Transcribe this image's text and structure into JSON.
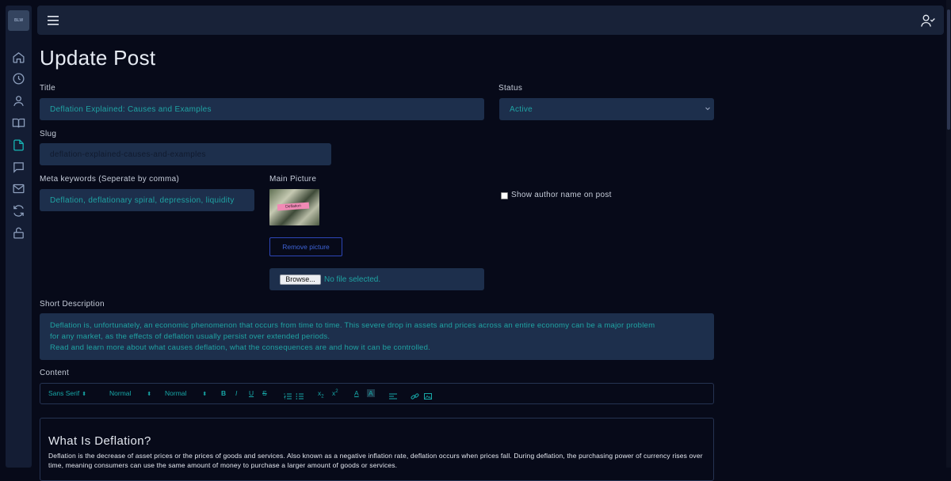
{
  "sidebar": {
    "logo_text": "BLW",
    "items": [
      {
        "icon": "home-icon"
      },
      {
        "icon": "clock-icon"
      },
      {
        "icon": "user-icon"
      },
      {
        "icon": "book-icon"
      },
      {
        "icon": "file-icon",
        "active": true
      },
      {
        "icon": "message-icon"
      },
      {
        "icon": "mail-icon"
      },
      {
        "icon": "refresh-icon"
      },
      {
        "icon": "unlock-icon"
      }
    ],
    "active_color": "#16b5b5",
    "icon_color": "#8ea0be"
  },
  "page": {
    "title": "Update Post"
  },
  "form": {
    "title_label": "Title",
    "title_value": "Deflation Explained: Causes and Examples",
    "status_label": "Status",
    "status_value": "Active",
    "slug_label": "Slug",
    "slug_value": "deflation-explained-causes-and-examples",
    "meta_label": "Meta keywords (Seperate by comma)",
    "meta_value": "Deflation, deflationary spiral, depression, liquidity",
    "picture_label": "Main Picture",
    "picture_tag": "Deflation",
    "remove_picture_label": "Remove picture",
    "browse_label": "Browse...",
    "file_status": "No file selected.",
    "show_author_label": "Show author name on post",
    "show_author_checked": false,
    "short_desc_label": "Short Description",
    "short_desc_lines": [
      "Deflation is, unfortunately, an economic phenomenon that occurs from time to time. This severe drop in assets and prices across an entire economy can be a major problem",
      "for any market, as the effects of deflation usually persist over extended periods.",
      "Read and learn more about what causes deflation, what the consequences are and how it can be controlled."
    ],
    "content_label": "Content"
  },
  "toolbar": {
    "font": "Sans Serif",
    "size": "Normal",
    "header": "Normal"
  },
  "editor": {
    "heading": "What Is Deflation?",
    "paragraph": "Deflation is the decrease of asset prices or the prices of goods and services. Also known as a negative inflation rate, deflation occurs when prices fall. During deflation, the purchasing power of currency rises over time, meaning consumers can use the same amount of money to purchase a larger amount of goods or services."
  },
  "colors": {
    "accent": "#1fa3a3",
    "field_bg": "#1d2f4c",
    "page_bg": "#070a19",
    "button_border": "#2d46b8"
  }
}
